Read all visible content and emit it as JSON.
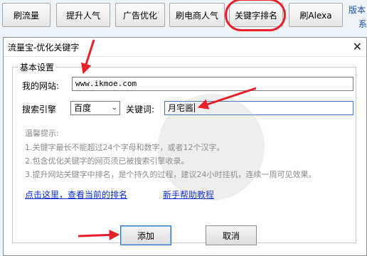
{
  "toolbar": {
    "buttons": [
      "刷流量",
      "提升人气",
      "广告优化",
      "刷电商人气",
      "关键字排名",
      "刷Alexa"
    ],
    "side_label_1": "版本",
    "side_label_2": "系"
  },
  "dialog": {
    "title": "流量宝-优化关键字",
    "group_title": "基本设置",
    "website_label": "我的网站:",
    "website_value": "www.ikmoe.com",
    "engine_label": "搜索引擎",
    "engine_value": "百度",
    "keyword_label": "关键词:",
    "keyword_value": "月宅酱",
    "hint_title": "温馨提示:",
    "hints": [
      "1.关键字最长不能超过24个字母和数字，或者12个汉字。",
      "2.包含优化关键字的网页须已被搜索引擎收录。",
      "3.提升网站关键字中排名，是个持久的过程，建议24小时挂机，连续一周可见效果。"
    ],
    "link_ranking": "点击这里，查看当前的排名",
    "link_help": "新手帮助教程",
    "add_button": "添加",
    "cancel_button": "取消"
  },
  "colors": {
    "annotation_red": "#e8202a",
    "link_blue": "#0b2bd0"
  }
}
